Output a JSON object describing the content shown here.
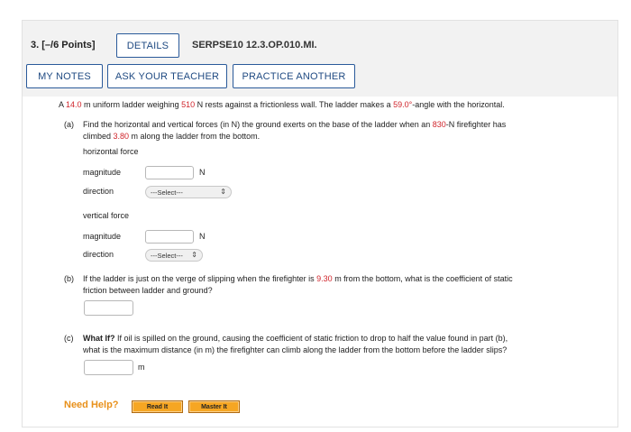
{
  "header": {
    "question_number": "3.",
    "points": "[–/6 Points]",
    "details_label": "DETAILS",
    "problem_code": "SERPSE10 12.3.OP.010.MI.",
    "my_notes_label": "MY NOTES",
    "ask_teacher_label": "ASK YOUR TEACHER",
    "practice_label": "PRACTICE ANOTHER"
  },
  "problem": {
    "intro_1": "A ",
    "length": "14.0",
    "intro_2": " m uniform ladder weighing ",
    "weight": "510",
    "intro_3": " N rests against a frictionless wall. The ladder makes a ",
    "angle": "59.0°",
    "intro_4": "-angle with the horizontal."
  },
  "part_a": {
    "label": "(a)",
    "text_1": "Find the horizontal and vertical forces (in N) the ground exerts on the base of the ladder when an ",
    "firefighter_weight": "830",
    "text_2": "-N firefighter has",
    "text_3": "climbed ",
    "distance": "3.80",
    "text_4": " m along the ladder from the bottom.",
    "horizontal_heading": "horizontal force",
    "vertical_heading": "vertical force",
    "magnitude_label": "magnitude",
    "direction_label": "direction",
    "unit_n": "N",
    "select_placeholder": "---Select---"
  },
  "part_b": {
    "label": "(b)",
    "text_1": "If the ladder is just on the verge of slipping when the firefighter is ",
    "distance": "9.30",
    "text_2": " m from the bottom, what is the coefficient of static",
    "text_3": "friction between ladder and ground?"
  },
  "part_c": {
    "label": "(c)",
    "bold": "What If?",
    "text_1": " If oil is spilled on the ground, causing the coefficient of static friction to drop to half the value found in part (b),",
    "text_2": "what is the maximum distance (in m) the firefighter can climb along the ladder from the bottom before the ladder slips?",
    "unit_m": "m"
  },
  "help": {
    "label": "Need Help?",
    "read_it": "Read It",
    "master_it": "Master It"
  },
  "colors": {
    "accent": "#2a5a9a",
    "given_value": "#d0242b",
    "help": "#e8901a",
    "help_button": "#f6a623"
  }
}
